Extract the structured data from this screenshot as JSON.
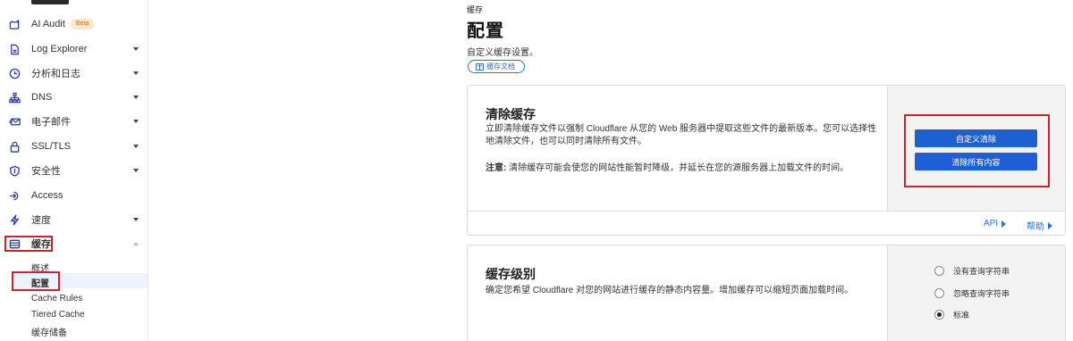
{
  "sidebar": {
    "items": [
      {
        "label": "AI Audit",
        "badge": "Beta",
        "icon": "ai-audit-icon",
        "caret": false
      },
      {
        "label": "Log Explorer",
        "icon": "log-icon",
        "caret": true
      },
      {
        "label": "分析和日志",
        "icon": "clock-icon",
        "caret": true
      },
      {
        "label": "DNS",
        "icon": "network-icon",
        "caret": true
      },
      {
        "label": "电子邮件",
        "icon": "email-icon",
        "caret": true
      },
      {
        "label": "SSL/TLS",
        "icon": "lock-icon",
        "caret": true
      },
      {
        "label": "安全性",
        "icon": "shield-icon",
        "caret": true
      },
      {
        "label": "Access",
        "icon": "access-icon",
        "caret": false
      },
      {
        "label": "速度",
        "icon": "lightning-icon",
        "caret": true
      },
      {
        "label": "缓存",
        "icon": "cache-icon",
        "caret": true,
        "expanded": true
      }
    ],
    "cache_sub": [
      "概述",
      "配置",
      "Cache Rules",
      "Tiered Cache",
      "缓存储备"
    ]
  },
  "main": {
    "breadcrumb": "缓存",
    "title": "配置",
    "subtitle": "自定义缓存设置。",
    "docs_label": "缓存文档",
    "purge": {
      "title": "清除缓存",
      "desc": "立即清除缓存文件以强制 Cloudflare 从您的 Web 服务器中提取这些文件的最新版本。您可以选择性地清除文件，也可以同时清除所有文件。",
      "note_label": "注意:",
      "note": "清除缓存可能会使您的网站性能暂时降级，并延长在您的源服务器上加载文件的时间。",
      "btn_custom": "自定义清除",
      "btn_all": "清除所有内容",
      "api_link": "API",
      "help_link": "帮助"
    },
    "level": {
      "title": "缓存级别",
      "desc": "确定您希望 Cloudflare 对您的网站进行缓存的静态内容量。增加缓存可以缩短页面加载时间。",
      "options": [
        "没有查询字符串",
        "忽略查询字符串",
        "标准"
      ],
      "selected": "标准"
    }
  },
  "colors": {
    "accent": "#1f5fd4",
    "highlight": "#d0222a",
    "icon": "#2f3e9e"
  }
}
